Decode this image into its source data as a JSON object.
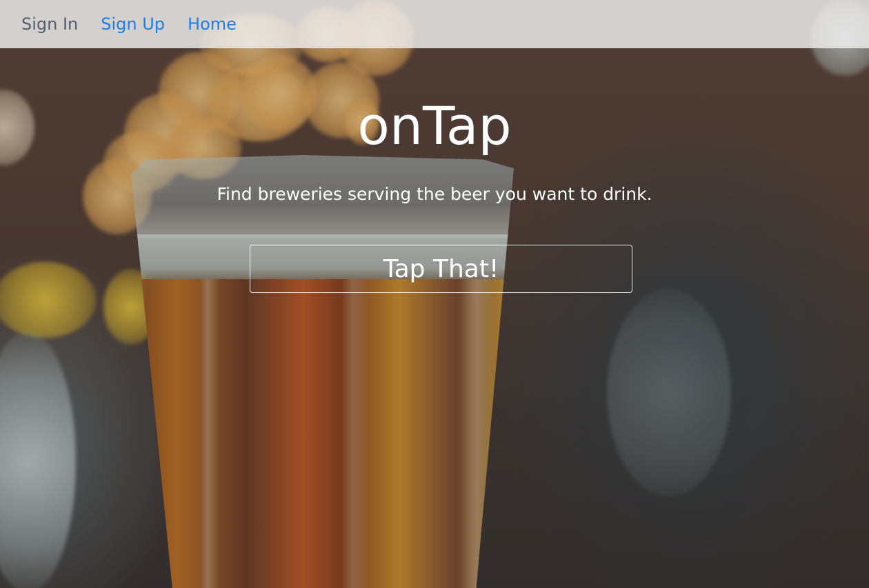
{
  "navbar": {
    "links": [
      {
        "label": "Sign In"
      },
      {
        "label": "Sign Up"
      },
      {
        "label": "Home"
      }
    ]
  },
  "hero": {
    "title": "onTap",
    "subtitle": "Find breweries serving the beer you want to drink.",
    "cta_label": "Tap That!"
  },
  "colors": {
    "nav_muted": "#52606c",
    "nav_link": "#1a7fe8",
    "hero_text": "#ffffff"
  }
}
